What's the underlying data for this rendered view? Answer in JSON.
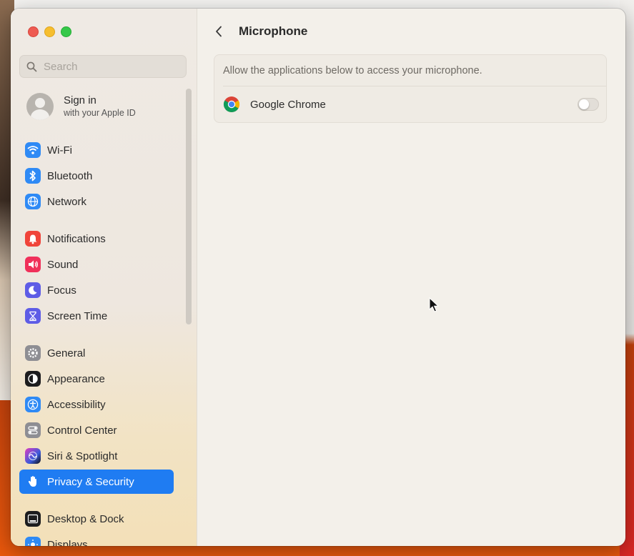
{
  "window": {
    "title": "Microphone",
    "traffic_lights": [
      "close",
      "minimize",
      "zoom"
    ]
  },
  "sidebar": {
    "search": {
      "placeholder": "Search",
      "value": ""
    },
    "account": {
      "title": "Sign in",
      "subtitle": "with your Apple ID"
    },
    "items": [
      {
        "label": "Wi-Fi",
        "icon": "wifi-icon",
        "color": "#2f8af5"
      },
      {
        "label": "Bluetooth",
        "icon": "bluetooth-icon",
        "color": "#2f8af5"
      },
      {
        "label": "Network",
        "icon": "globe-icon",
        "color": "#2f8af5"
      },
      {
        "label": "Notifications",
        "icon": "bell-icon",
        "color": "#f0443a"
      },
      {
        "label": "Sound",
        "icon": "speaker-icon",
        "color": "#f0305a"
      },
      {
        "label": "Focus",
        "icon": "moon-icon",
        "color": "#5e5ce6"
      },
      {
        "label": "Screen Time",
        "icon": "hourglass-icon",
        "color": "#5e5ce6"
      },
      {
        "label": "General",
        "icon": "gear-icon",
        "color": "#8e8e93"
      },
      {
        "label": "Appearance",
        "icon": "appearance-icon",
        "color": "#1c1c1e"
      },
      {
        "label": "Accessibility",
        "icon": "accessibility-icon",
        "color": "#2f8af5"
      },
      {
        "label": "Control Center",
        "icon": "control-center-icon",
        "color": "#8e8e93"
      },
      {
        "label": "Siri & Spotlight",
        "icon": "siri-icon",
        "color": "#c02fd6"
      },
      {
        "label": "Privacy & Security",
        "icon": "hand-icon",
        "color": "#2f8af5",
        "active": true
      },
      {
        "label": "Desktop & Dock",
        "icon": "dock-icon",
        "color": "#1c1c1e"
      },
      {
        "label": "Displays",
        "icon": "display-icon",
        "color": "#2f8af5"
      }
    ]
  },
  "main": {
    "back_icon": "chevron-left-icon",
    "title": "Microphone",
    "description": "Allow the applications below to access your microphone.",
    "apps": [
      {
        "name": "Google Chrome",
        "icon": "chrome-icon",
        "enabled": false
      }
    ]
  },
  "colors": {
    "accent": "#1f7cf2"
  }
}
